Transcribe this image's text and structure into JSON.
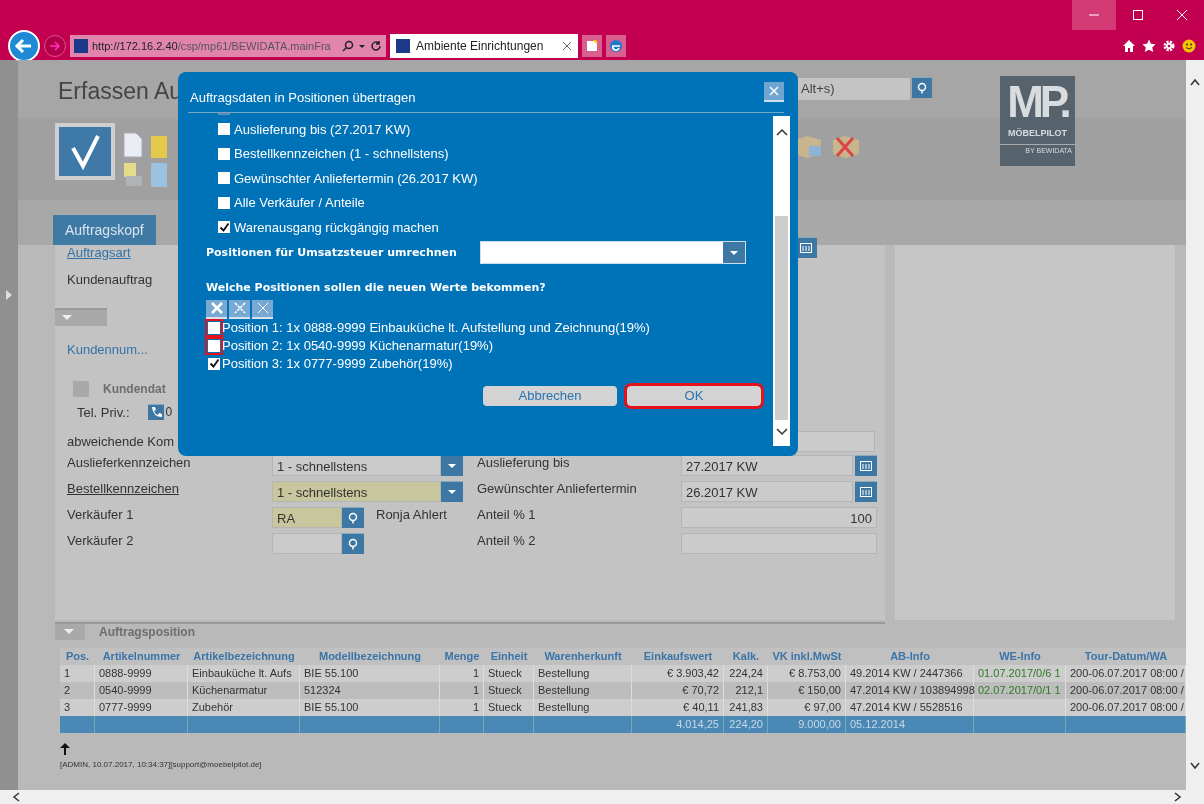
{
  "browser": {
    "url_host": "http://172.16.2.40",
    "url_path": "/csp/mp61/BEWIDATA.mainFra",
    "tab_title": "Ambiente Einrichtungen"
  },
  "page": {
    "title": "Erfassen Au",
    "search_placeholder": "Alt+s)",
    "logo_text": "MP.",
    "logo_name": "MÖBELPILOT",
    "logo_sub": "BY BEWIDATA",
    "tabs": [
      {
        "label": "Auftragskopf",
        "selected": true
      }
    ],
    "order_type_label": "Auftragsart",
    "order_type_value": "Kundenauftrag",
    "customer_link": "Kundennum...",
    "customer_section": "Kundendat",
    "phone_label": "Tel. Priv.:",
    "phone_value": "0",
    "deviating_label": "abweichende Kom",
    "form_rows": [
      {
        "label": "Auslieferkennzeichen",
        "underlined": false,
        "kind": "select",
        "value": "1 - schnellstens",
        "required": false,
        "second": {
          "label": "Auslieferung bis",
          "value": "27.2017 KW",
          "kind": "date"
        }
      },
      {
        "label": "Bestellkennzeichen",
        "underlined": true,
        "kind": "select",
        "value": "1 - schnellstens",
        "required": true,
        "second": {
          "label": "Gewünschter Anliefertermin",
          "value": "26.2017 KW",
          "kind": "date"
        }
      },
      {
        "label": "Verkäufer 1",
        "underlined": false,
        "kind": "lookup",
        "value": "RA",
        "required": true,
        "name": "Ronja Ahlert",
        "second": {
          "label": "Anteil % 1",
          "value": "100",
          "kind": "number"
        }
      },
      {
        "label": "Verkäufer 2",
        "underlined": false,
        "kind": "lookup",
        "required": false,
        "second": {
          "label": "Anteil % 2",
          "kind": "number"
        }
      }
    ],
    "positions_section": "Auftragsposition",
    "table": {
      "columns": [
        "Pos.",
        "Artikelnummer",
        "Artikelbezeichnung",
        "Modellbezeichnung",
        "Menge",
        "Einheit",
        "Warenherkunft",
        "Einkaufswert",
        "Kalk.",
        "VK inkl.MwSt",
        "AB-Info",
        "WE-Info",
        "Tour-Datum/WA"
      ],
      "rows": [
        [
          "1",
          "0888-9999",
          "Einbauküche lt. Aufs",
          "BIE 55.100",
          "1",
          "Stueck",
          "Bestellung",
          "€ 3.903,42",
          "224,24",
          "€ 8.753,00",
          "49.2014 KW / 2447366",
          "01.07.2017/0/6 1",
          "200-06.07.2017 08:00 /"
        ],
        [
          "2",
          "0540-9999",
          "Küchenarmatur",
          "512324",
          "1",
          "Stueck",
          "Bestellung",
          "€ 70,72",
          "212,1",
          "€ 150,00",
          "47.2014 KW / 103894998",
          "02.07.2017/0/1 1",
          "200-06.07.2017 08:00 /"
        ],
        [
          "3",
          "0777-9999",
          "Zubehör",
          "BIE 55.100",
          "1",
          "Stueck",
          "Bestellung",
          "€ 40,11",
          "241,83",
          "€ 97,00",
          "47.2014 KW / 5528516",
          "",
          "200-06.07.2017 08:00 /"
        ]
      ],
      "totals": {
        "einkaufswert": "4.014,25",
        "kalk": "224,20",
        "vk_inkl_mwst": "9.000,00",
        "ab_info": "05.12.2014"
      }
    },
    "footer": "[ADMIN, 10.07.2017, 10:34:37][support@moebelpilot.de]"
  },
  "dialog": {
    "title": "Auftragsdaten in Positionen übertragen",
    "options": [
      {
        "label": "Auslieferung bis (27.2017 KW)",
        "checked": false
      },
      {
        "label": "Bestellkennzeichen (1 - schnellstens)",
        "checked": false
      },
      {
        "label": "Gewünschter Anliefertermin (26.2017 KW)",
        "checked": false
      },
      {
        "label": "Alle Verkäufer / Anteile",
        "checked": false
      },
      {
        "label": "Warenausgang rückgängig machen",
        "checked": true
      }
    ],
    "tax_label": "Positionen für Umsatzsteuer umrechnen",
    "positions_heading": "Welche Positionen sollen die neuen Werte bekommen?",
    "positions": [
      {
        "label": "Position 1: 1x 0888-9999 Einbauküche lt. Aufstellung und Zeichnung(19%)",
        "checked": false,
        "highlighted": true
      },
      {
        "label": "Position 2: 1x 0540-9999 Küchenarmatur(19%)",
        "checked": false,
        "highlighted": true
      },
      {
        "label": "Position 3: 1x 0777-9999 Zubehör(19%)",
        "checked": true,
        "highlighted": false
      }
    ],
    "buttons": [
      {
        "label": "Abbrechen",
        "highlighted": false
      },
      {
        "label": "OK",
        "highlighted": true
      }
    ]
  }
}
